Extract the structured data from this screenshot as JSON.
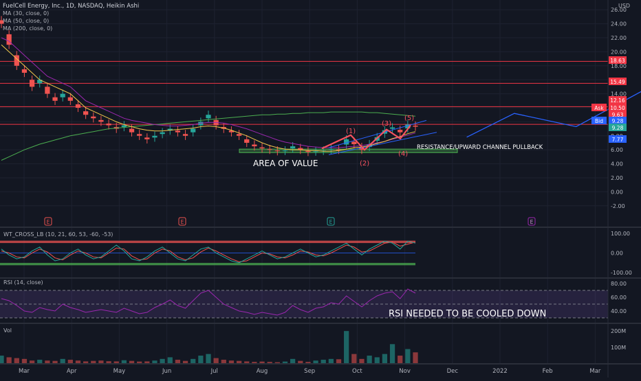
{
  "header": {
    "symbol_line": "FuelCell Energy, Inc., 1D, NASDAQ, Heikin Ashi",
    "ma_labels": [
      "MA (30, close, 0)",
      "MA (50, close, 0)",
      "MA (200, close, 0)"
    ],
    "currency": "USD"
  },
  "colors": {
    "background": "#131722",
    "grid": "#1e2230",
    "axis_text": "#b2b5be",
    "up": "#26a69a",
    "down": "#ef5350",
    "ma30": "#f2c94c",
    "ma50": "#9c27b0",
    "ma200": "#4caf50",
    "resistance": "#f23645",
    "projection": "#2962ff",
    "zone": "#4caf50",
    "wave": "#f7525f"
  },
  "chart_data": [
    {
      "type": "candlestick",
      "x_tick_labels": [
        "Mar",
        "Apr",
        "May",
        "Jun",
        "Jul",
        "Aug",
        "Sep",
        "Oct",
        "Nov",
        "Dec",
        "2022",
        "Feb",
        "Mar"
      ],
      "y_tick_labels": [
        "26.00",
        "24.00",
        "22.00",
        "20.00",
        "18.00",
        "16.00",
        "14.00",
        "12.00",
        "10.00",
        "8.00",
        "6.00",
        "4.00",
        "2.00",
        "0.00",
        "-2.00"
      ],
      "y_range": [
        -3,
        27
      ],
      "horizontal_levels": [
        18.63,
        15.49,
        12.16,
        9.63
      ],
      "price_tags": [
        {
          "label": "",
          "value": "18.63",
          "color": "#f23645"
        },
        {
          "label": "",
          "value": "15.49",
          "color": "#f23645"
        },
        {
          "label": "",
          "value": "12.16",
          "color": "#f23645"
        },
        {
          "label": "Ask",
          "value": "10.50",
          "color": "#f23645"
        },
        {
          "label": "",
          "value": "9.63",
          "color": "#f23645"
        },
        {
          "label": "Bid",
          "value": "9.28",
          "color": "#2962ff"
        },
        {
          "label": "",
          "value": "9.28",
          "color": "#26a69a"
        },
        {
          "label": "",
          "value": "7.77",
          "color": "#2962ff"
        }
      ],
      "close_series": [
        24,
        21,
        18,
        17,
        15,
        16,
        14,
        13,
        14,
        13,
        12,
        11,
        10.5,
        10,
        9.5,
        9,
        9.5,
        8.5,
        8,
        7.5,
        8,
        8.5,
        9,
        8.5,
        8,
        9,
        10,
        11,
        9.5,
        9,
        8.5,
        8,
        7,
        6.5,
        6.2,
        6,
        5.8,
        5.9,
        6.5,
        6,
        5.7,
        5.8,
        5.9,
        6.1,
        6,
        7.5,
        6.8,
        6,
        6.8,
        7.8,
        8.8,
        9.2,
        8.5,
        9.6,
        9.3
      ],
      "ma30": [
        21,
        20,
        19,
        18,
        17,
        16,
        15.5,
        15,
        14.5,
        14,
        13,
        12,
        11.5,
        11,
        10.5,
        10,
        9.6,
        9.3,
        9,
        8.8,
        8.7,
        8.7,
        8.8,
        8.9,
        9,
        9.1,
        9.3,
        9.4,
        9.3,
        9.1,
        8.8,
        8.4,
        8,
        7.5,
        7,
        6.6,
        6.3,
        6.1,
        6,
        6,
        5.9,
        5.9,
        5.8,
        5.8,
        5.9,
        6.1,
        6.3,
        6.4,
        6.6,
        6.9,
        7.2,
        7.6,
        7.9,
        8.3,
        8.6
      ],
      "ma50": [
        22,
        21.5,
        20.5,
        19.5,
        18.5,
        17.5,
        16.5,
        16,
        15.5,
        15,
        14,
        13,
        12.5,
        12,
        11.5,
        11,
        10.5,
        10.2,
        10,
        9.8,
        9.6,
        9.5,
        9.4,
        9.4,
        9.5,
        9.6,
        9.8,
        9.9,
        9.9,
        9.8,
        9.6,
        9.3,
        9,
        8.6,
        8.2,
        7.8,
        7.4,
        7.1,
        6.9,
        6.7,
        6.5,
        6.4,
        6.3,
        6.3,
        6.3,
        6.4,
        6.5,
        6.6,
        6.8,
        7,
        7.2,
        7.5,
        7.8,
        8.1,
        8.4
      ],
      "ma200": [
        4.5,
        5,
        5.5,
        6,
        6.4,
        6.8,
        7.1,
        7.4,
        7.7,
        8,
        8.2,
        8.4,
        8.6,
        8.8,
        9,
        9.1,
        9.2,
        9.3,
        9.4,
        9.5,
        9.6,
        9.7,
        9.8,
        9.9,
        10,
        10.1,
        10.2,
        10.3,
        10.4,
        10.5,
        10.6,
        10.7,
        10.8,
        10.9,
        11,
        11,
        11.1,
        11.1,
        11.2,
        11.2,
        11.3,
        11.3,
        11.3,
        11.4,
        11.4,
        11.4,
        11.4,
        11.4,
        11.3,
        11.3,
        11.2,
        11.1,
        11,
        10.9,
        10.8
      ],
      "projection_path": [
        [
          9.3,
          7.8
        ],
        [
          10.3,
          11.2
        ],
        [
          11.6,
          9.3
        ],
        [
          13.1,
          14.8
        ]
      ],
      "earnings_markers": [
        "E",
        "E",
        "E",
        "E"
      ],
      "annotations": {
        "wave_labels": [
          "(1)",
          "(2)",
          "(3)",
          "(4)",
          "(5)"
        ],
        "channel_label": "RESISTANCE/UPWARD CHANNEL PULLBACK",
        "value_label": "AREA OF VALUE"
      }
    },
    {
      "type": "line",
      "title": "WT_CROSS_LB (10, 21, 60, 53, -60, -53)",
      "y_tick_labels": [
        "100.00",
        "0.00",
        "-100.00"
      ],
      "y_range": [
        -110,
        110
      ],
      "levels": [
        60,
        53,
        0,
        -53,
        -60
      ],
      "series": [
        {
          "values": [
            20,
            -10,
            -30,
            -20,
            10,
            30,
            -10,
            -40,
            -30,
            0,
            20,
            -10,
            -30,
            -20,
            10,
            40,
            10,
            -30,
            -40,
            -20,
            10,
            30,
            0,
            -30,
            -40,
            -10,
            20,
            30,
            0,
            -20,
            -40,
            -50,
            -30,
            -10,
            10,
            -10,
            -30,
            -20,
            0,
            20,
            0,
            -20,
            -10,
            10,
            30,
            50,
            20,
            -10,
            20,
            40,
            60,
            50,
            20,
            60,
            50
          ]
        },
        {
          "values": [
            10,
            0,
            -20,
            -25,
            0,
            20,
            5,
            -25,
            -35,
            -10,
            10,
            0,
            -20,
            -25,
            0,
            25,
            20,
            -15,
            -35,
            -30,
            0,
            20,
            10,
            -20,
            -35,
            -25,
            5,
            25,
            10,
            -10,
            -30,
            -45,
            -40,
            -20,
            0,
            -5,
            -20,
            -25,
            -10,
            10,
            5,
            -10,
            -15,
            0,
            20,
            40,
            30,
            5,
            10,
            30,
            50,
            55,
            35,
            45,
            55
          ]
        }
      ]
    },
    {
      "type": "line",
      "title": "RSI (14, close)",
      "y_tick_labels": [
        "80.00",
        "60.00",
        "40.00"
      ],
      "y_range": [
        25,
        85
      ],
      "levels": [
        70,
        50,
        30
      ],
      "series": [
        {
          "values": [
            58,
            55,
            48,
            40,
            38,
            45,
            42,
            40,
            50,
            45,
            42,
            38,
            40,
            42,
            40,
            38,
            44,
            40,
            36,
            38,
            45,
            50,
            56,
            48,
            44,
            55,
            66,
            70,
            60,
            50,
            45,
            40,
            38,
            35,
            38,
            36,
            34,
            38,
            48,
            42,
            38,
            44,
            46,
            52,
            50,
            62,
            54,
            46,
            55,
            62,
            66,
            68,
            58,
            72,
            66
          ]
        }
      ],
      "annotation": "RSI NEEDED TO BE COOLED DOWN"
    },
    {
      "type": "bar",
      "title": "Vol",
      "y_tick_labels": [
        "200M",
        "100M"
      ],
      "values": [
        50,
        40,
        35,
        30,
        20,
        25,
        20,
        18,
        30,
        25,
        20,
        15,
        18,
        20,
        16,
        15,
        22,
        18,
        14,
        15,
        20,
        30,
        40,
        25,
        18,
        30,
        50,
        60,
        35,
        25,
        20,
        18,
        15,
        12,
        14,
        12,
        10,
        14,
        30,
        18,
        12,
        20,
        25,
        30,
        28,
        200,
        60,
        30,
        50,
        40,
        60,
        120,
        50,
        90,
        70
      ]
    }
  ]
}
